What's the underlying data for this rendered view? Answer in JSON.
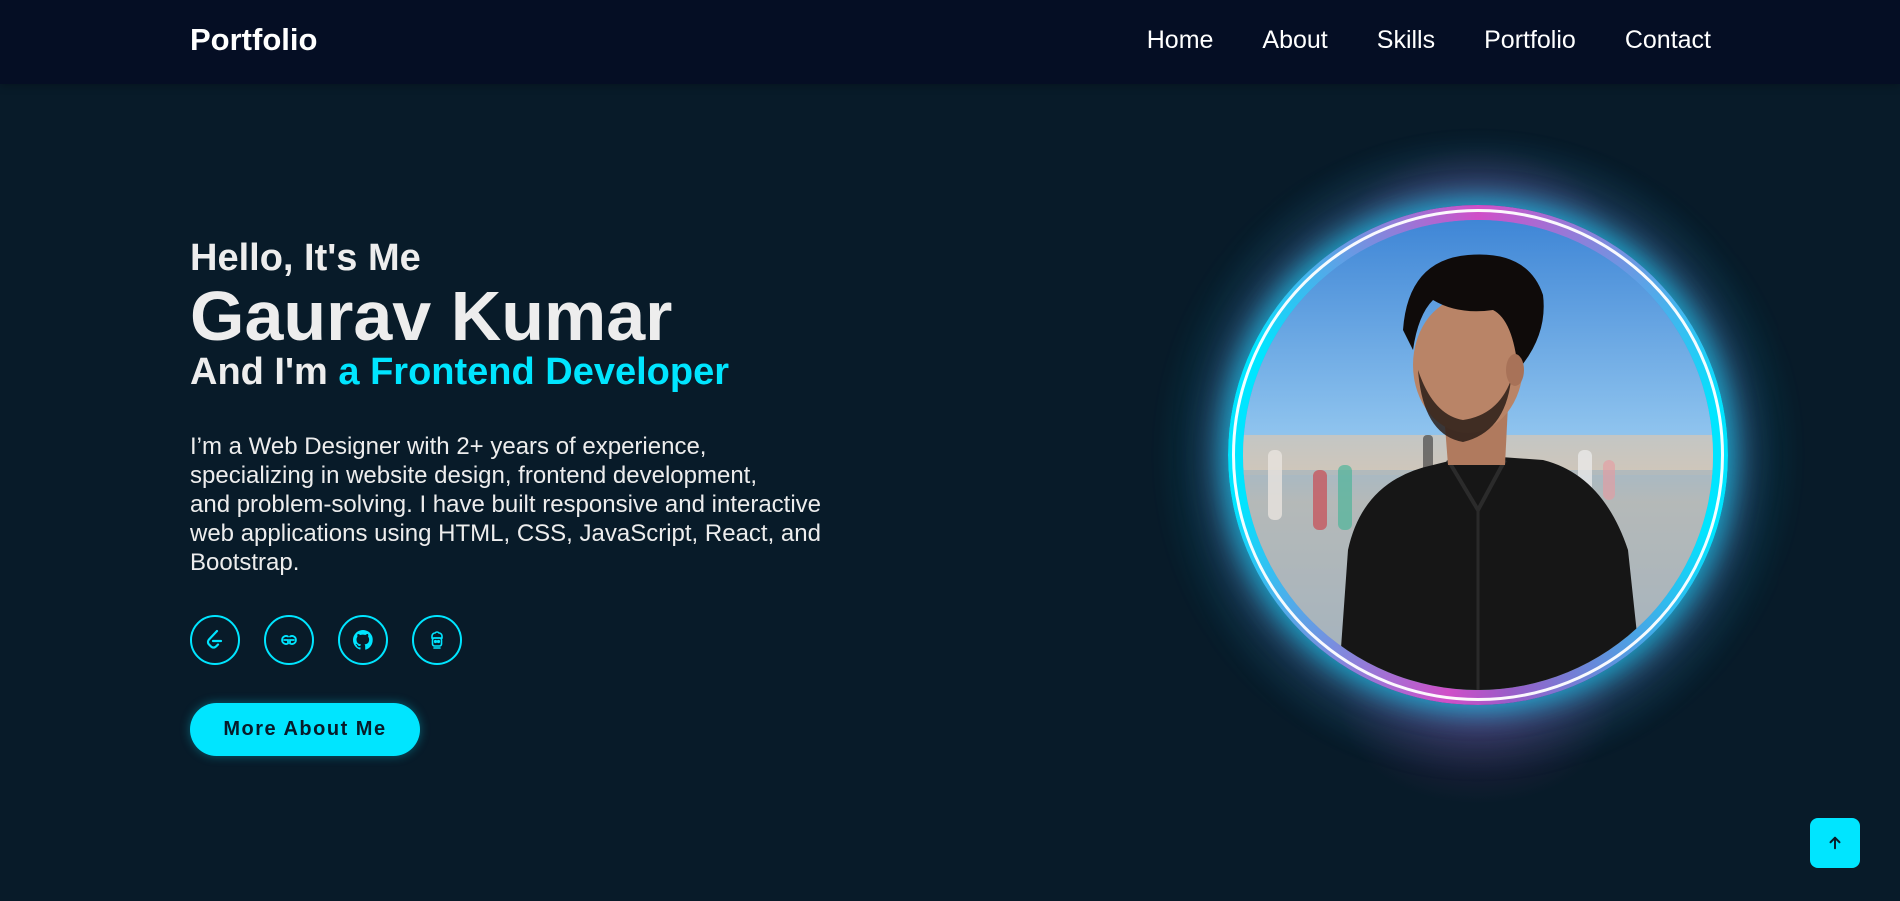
{
  "nav": {
    "logo": "Portfolio",
    "links": [
      "Home",
      "About",
      "Skills",
      "Portfolio",
      "Contact"
    ]
  },
  "hero": {
    "greeting": "Hello, It's Me",
    "name": "Gaurav Kumar",
    "role_prefix": "And I'm ",
    "role_accent": "a Frontend Developer",
    "bio_lines": [
      "I’m a Web Designer with 2+ years of experience,",
      "specializing in website design, frontend development,",
      "and problem-solving. I have built responsive and interactive",
      "web applications using HTML, CSS, JavaScript, React, and",
      "Bootstrap."
    ],
    "socials": [
      "leetcode-icon",
      "geeksforgeeks-icon",
      "github-icon",
      "codechef-icon"
    ],
    "button_label": "More About Me"
  },
  "colors": {
    "background": "#081b29",
    "navbar": "#050e24",
    "accent": "#00e5ff",
    "ring_magenta": "#d04fc8"
  },
  "scroll_top_icon": "arrow-up-icon"
}
